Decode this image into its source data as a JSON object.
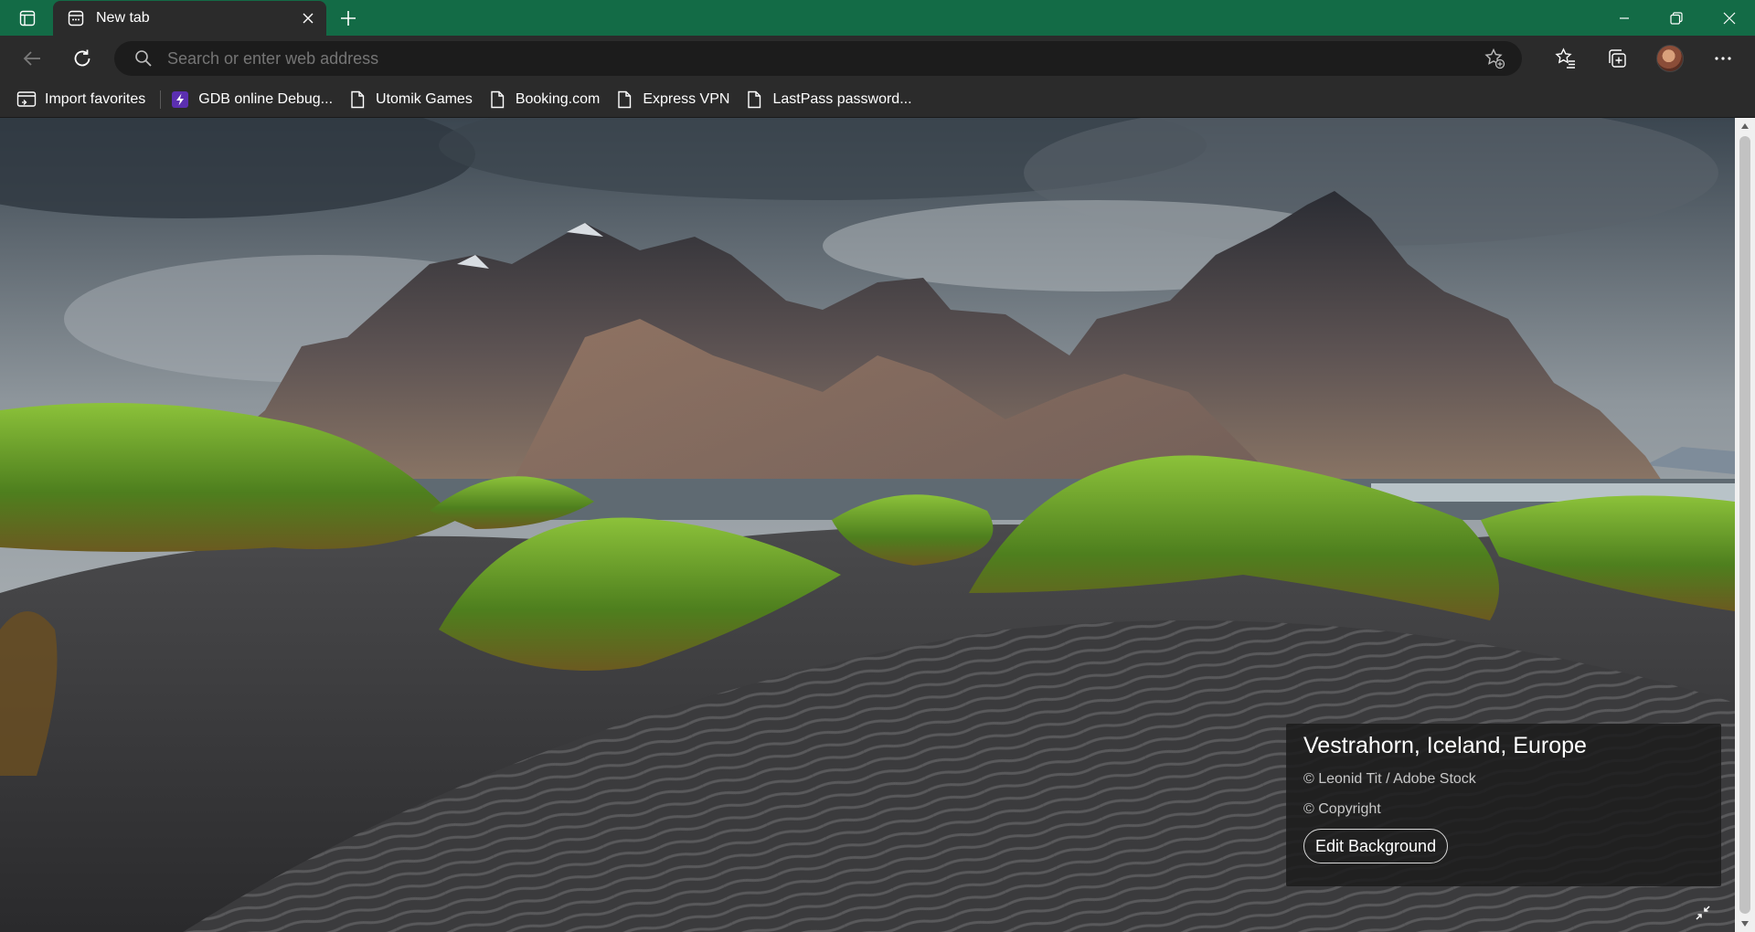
{
  "browser": {
    "tab": {
      "title": "New tab"
    },
    "addressbar": {
      "placeholder": "Search or enter web address"
    }
  },
  "favorites": [
    {
      "label": "Import favorites",
      "icon": "import-favorites-icon"
    },
    {
      "label": "GDB online Debug...",
      "icon": "bolt-icon"
    },
    {
      "label": "Utomik Games",
      "icon": "page-icon"
    },
    {
      "label": "Booking.com",
      "icon": "page-icon"
    },
    {
      "label": "Express VPN",
      "icon": "page-icon"
    },
    {
      "label": "LastPass password...",
      "icon": "page-icon"
    }
  ],
  "background_info": {
    "title": "Vestrahorn, Iceland, Europe",
    "credit": "© Leonid Tit / Adobe Stock",
    "copyright": "© Copyright",
    "edit_button": "Edit Background"
  },
  "colors": {
    "titlebar": "#136b46",
    "toolbar": "#2b2b2b",
    "addressbar": "#1c1c1c",
    "accent_bolt": "#5b2fb0"
  }
}
